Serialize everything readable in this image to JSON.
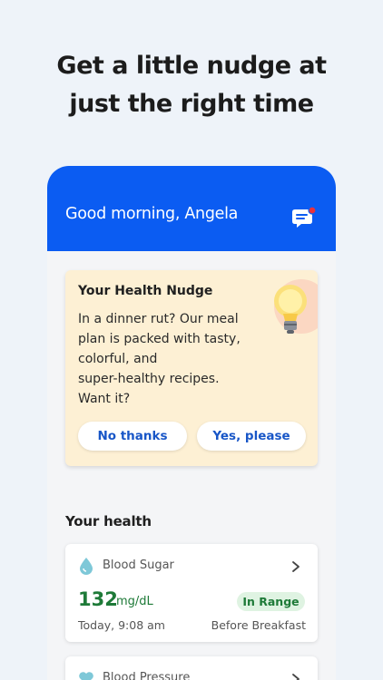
{
  "promo": {
    "headline_line1": "Get a little nudge at",
    "headline_line2": "just the right time"
  },
  "header": {
    "greeting": "Good morning, Angela",
    "chat_icon": "chat-bubble-icon",
    "accent_color": "#0b5cf2"
  },
  "nudge": {
    "title": "Your Health Nudge",
    "body_lines": [
      "In a dinner rut? Our meal",
      "plan is packed with tasty,",
      "colorful, and",
      "super-healthy recipes.",
      "Want it?"
    ],
    "icon": "lightbulb-icon",
    "decline_label": "No thanks",
    "accept_label": "Yes, please",
    "background": "#fdf0d4"
  },
  "health": {
    "section_title": "Your health",
    "blood_sugar": {
      "icon": "droplet-icon",
      "name": "Blood Sugar",
      "value": "132",
      "unit": "mg/dL",
      "status": "In Range",
      "time": "Today, 9:08 am",
      "context": "Before Breakfast",
      "status_color": "#1e7a38"
    },
    "blood_pressure": {
      "icon": "heart-icon",
      "name": "Blood Pressure"
    }
  }
}
